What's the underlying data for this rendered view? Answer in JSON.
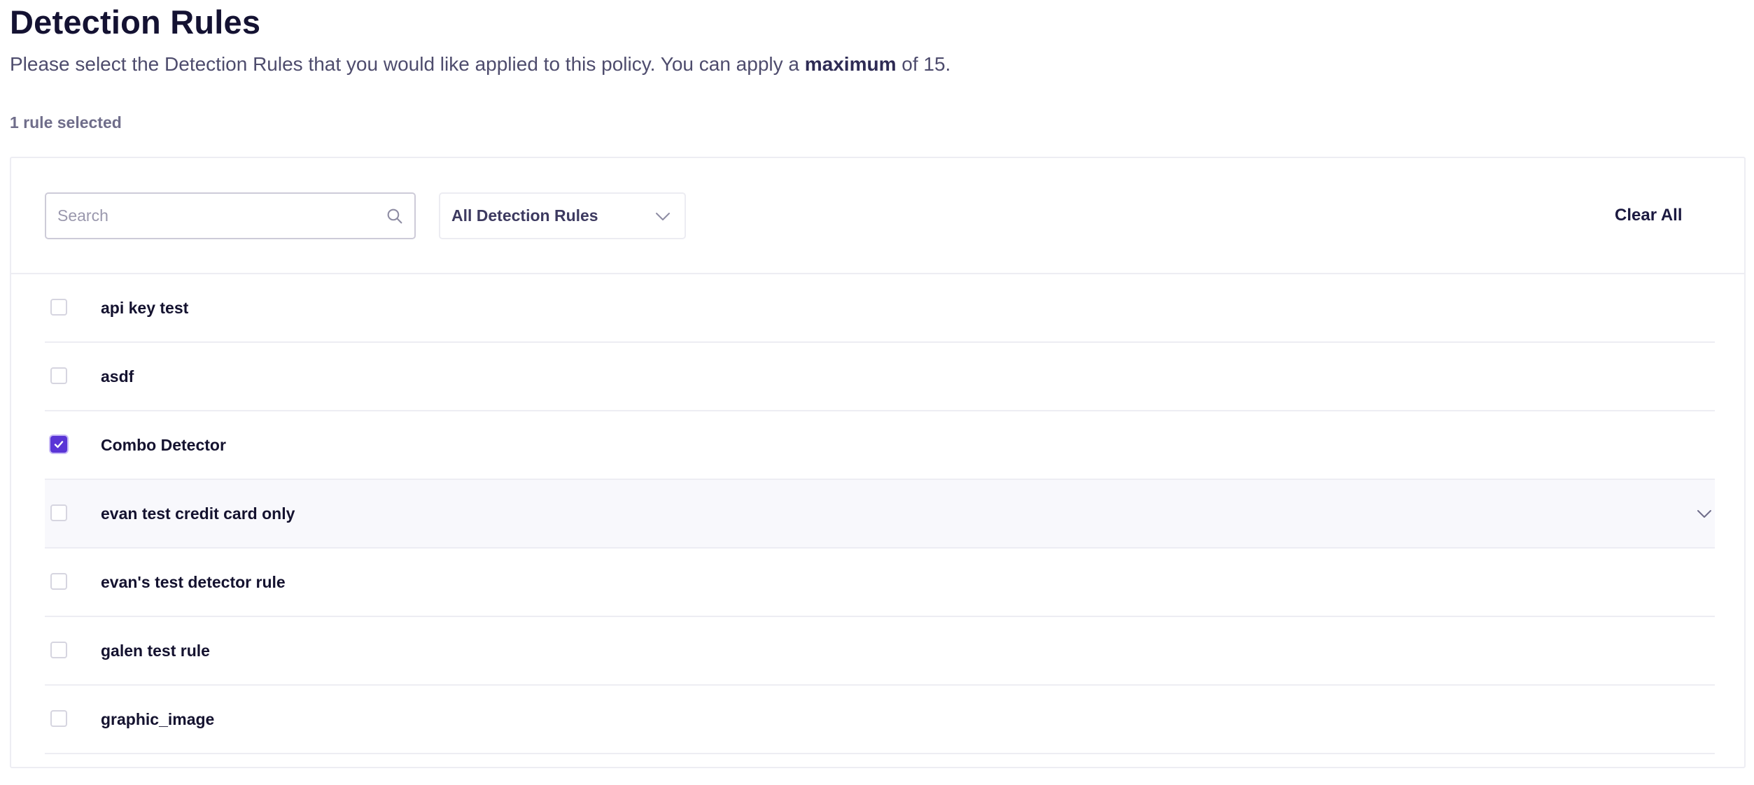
{
  "header": {
    "title": "Detection Rules",
    "description_before": "Please select the Detection Rules that you would like applied to this policy. You can apply a ",
    "description_emphasis": "maximum",
    "description_after": " of 15.",
    "selected_count": "1 rule selected"
  },
  "toolbar": {
    "search_placeholder": "Search",
    "search_value": "",
    "search_icon": "search-icon",
    "filter_label": "All Detection Rules",
    "filter_icon": "chevron-down-icon",
    "clear_all_label": "Clear All"
  },
  "rules": [
    {
      "label": "api key test",
      "checked": false
    },
    {
      "label": "asdf",
      "checked": false
    },
    {
      "label": "Combo Detector",
      "checked": true
    },
    {
      "label": "evan test credit card only",
      "checked": false,
      "expandable": true
    },
    {
      "label": "evan's test detector rule",
      "checked": false
    },
    {
      "label": "galen test rule",
      "checked": false
    },
    {
      "label": "graphic_image",
      "checked": false
    }
  ],
  "colors": {
    "accent": "#5a35d6",
    "title": "#141232",
    "muted_text": "#6f6d8a",
    "border": "#ededf3",
    "hover_row": "#f8f8fc"
  }
}
